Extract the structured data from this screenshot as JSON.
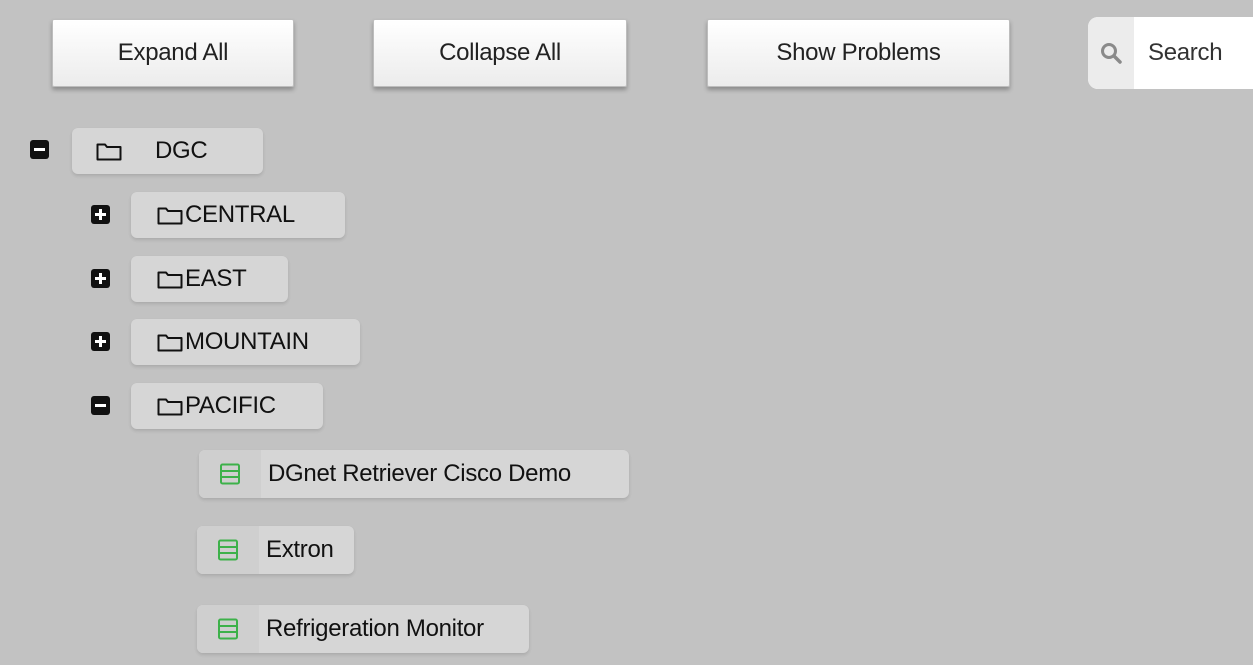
{
  "toolbar": {
    "expand_all_label": "Expand All",
    "collapse_all_label": "Collapse All",
    "show_problems_label": "Show Problems",
    "search_placeholder": "Search"
  },
  "tree": {
    "root": {
      "label": "DGC",
      "state": "expanded"
    },
    "groups": [
      {
        "label": "CENTRAL",
        "state": "collapsed"
      },
      {
        "label": "EAST",
        "state": "collapsed"
      },
      {
        "label": "MOUNTAIN",
        "state": "collapsed"
      },
      {
        "label": "PACIFIC",
        "state": "expanded"
      }
    ],
    "devices": [
      {
        "label": "DGnet Retriever Cisco Demo",
        "icon": "server-icon"
      },
      {
        "label": "Extron",
        "icon": "server-icon"
      },
      {
        "label": "Refrigeration Monitor",
        "icon": "server-icon"
      }
    ]
  },
  "colors": {
    "background": "#c2c2c2",
    "node_background": "#d6d6d6",
    "device_icon": "#3db14a",
    "toggle": "#111111"
  }
}
